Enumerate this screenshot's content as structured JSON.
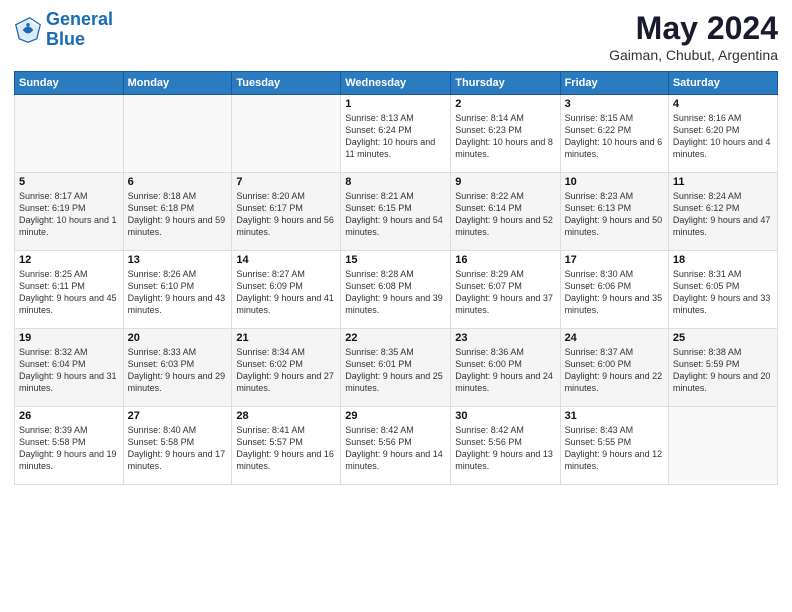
{
  "logo": {
    "line1": "General",
    "line2": "Blue"
  },
  "title": "May 2024",
  "subtitle": "Gaiman, Chubut, Argentina",
  "days_header": [
    "Sunday",
    "Monday",
    "Tuesday",
    "Wednesday",
    "Thursday",
    "Friday",
    "Saturday"
  ],
  "weeks": [
    [
      {
        "day": "",
        "sunrise": "",
        "sunset": "",
        "daylight": ""
      },
      {
        "day": "",
        "sunrise": "",
        "sunset": "",
        "daylight": ""
      },
      {
        "day": "",
        "sunrise": "",
        "sunset": "",
        "daylight": ""
      },
      {
        "day": "1",
        "sunrise": "Sunrise: 8:13 AM",
        "sunset": "Sunset: 6:24 PM",
        "daylight": "Daylight: 10 hours and 11 minutes."
      },
      {
        "day": "2",
        "sunrise": "Sunrise: 8:14 AM",
        "sunset": "Sunset: 6:23 PM",
        "daylight": "Daylight: 10 hours and 8 minutes."
      },
      {
        "day": "3",
        "sunrise": "Sunrise: 8:15 AM",
        "sunset": "Sunset: 6:22 PM",
        "daylight": "Daylight: 10 hours and 6 minutes."
      },
      {
        "day": "4",
        "sunrise": "Sunrise: 8:16 AM",
        "sunset": "Sunset: 6:20 PM",
        "daylight": "Daylight: 10 hours and 4 minutes."
      }
    ],
    [
      {
        "day": "5",
        "sunrise": "Sunrise: 8:17 AM",
        "sunset": "Sunset: 6:19 PM",
        "daylight": "Daylight: 10 hours and 1 minute."
      },
      {
        "day": "6",
        "sunrise": "Sunrise: 8:18 AM",
        "sunset": "Sunset: 6:18 PM",
        "daylight": "Daylight: 9 hours and 59 minutes."
      },
      {
        "day": "7",
        "sunrise": "Sunrise: 8:20 AM",
        "sunset": "Sunset: 6:17 PM",
        "daylight": "Daylight: 9 hours and 56 minutes."
      },
      {
        "day": "8",
        "sunrise": "Sunrise: 8:21 AM",
        "sunset": "Sunset: 6:15 PM",
        "daylight": "Daylight: 9 hours and 54 minutes."
      },
      {
        "day": "9",
        "sunrise": "Sunrise: 8:22 AM",
        "sunset": "Sunset: 6:14 PM",
        "daylight": "Daylight: 9 hours and 52 minutes."
      },
      {
        "day": "10",
        "sunrise": "Sunrise: 8:23 AM",
        "sunset": "Sunset: 6:13 PM",
        "daylight": "Daylight: 9 hours and 50 minutes."
      },
      {
        "day": "11",
        "sunrise": "Sunrise: 8:24 AM",
        "sunset": "Sunset: 6:12 PM",
        "daylight": "Daylight: 9 hours and 47 minutes."
      }
    ],
    [
      {
        "day": "12",
        "sunrise": "Sunrise: 8:25 AM",
        "sunset": "Sunset: 6:11 PM",
        "daylight": "Daylight: 9 hours and 45 minutes."
      },
      {
        "day": "13",
        "sunrise": "Sunrise: 8:26 AM",
        "sunset": "Sunset: 6:10 PM",
        "daylight": "Daylight: 9 hours and 43 minutes."
      },
      {
        "day": "14",
        "sunrise": "Sunrise: 8:27 AM",
        "sunset": "Sunset: 6:09 PM",
        "daylight": "Daylight: 9 hours and 41 minutes."
      },
      {
        "day": "15",
        "sunrise": "Sunrise: 8:28 AM",
        "sunset": "Sunset: 6:08 PM",
        "daylight": "Daylight: 9 hours and 39 minutes."
      },
      {
        "day": "16",
        "sunrise": "Sunrise: 8:29 AM",
        "sunset": "Sunset: 6:07 PM",
        "daylight": "Daylight: 9 hours and 37 minutes."
      },
      {
        "day": "17",
        "sunrise": "Sunrise: 8:30 AM",
        "sunset": "Sunset: 6:06 PM",
        "daylight": "Daylight: 9 hours and 35 minutes."
      },
      {
        "day": "18",
        "sunrise": "Sunrise: 8:31 AM",
        "sunset": "Sunset: 6:05 PM",
        "daylight": "Daylight: 9 hours and 33 minutes."
      }
    ],
    [
      {
        "day": "19",
        "sunrise": "Sunrise: 8:32 AM",
        "sunset": "Sunset: 6:04 PM",
        "daylight": "Daylight: 9 hours and 31 minutes."
      },
      {
        "day": "20",
        "sunrise": "Sunrise: 8:33 AM",
        "sunset": "Sunset: 6:03 PM",
        "daylight": "Daylight: 9 hours and 29 minutes."
      },
      {
        "day": "21",
        "sunrise": "Sunrise: 8:34 AM",
        "sunset": "Sunset: 6:02 PM",
        "daylight": "Daylight: 9 hours and 27 minutes."
      },
      {
        "day": "22",
        "sunrise": "Sunrise: 8:35 AM",
        "sunset": "Sunset: 6:01 PM",
        "daylight": "Daylight: 9 hours and 25 minutes."
      },
      {
        "day": "23",
        "sunrise": "Sunrise: 8:36 AM",
        "sunset": "Sunset: 6:00 PM",
        "daylight": "Daylight: 9 hours and 24 minutes."
      },
      {
        "day": "24",
        "sunrise": "Sunrise: 8:37 AM",
        "sunset": "Sunset: 6:00 PM",
        "daylight": "Daylight: 9 hours and 22 minutes."
      },
      {
        "day": "25",
        "sunrise": "Sunrise: 8:38 AM",
        "sunset": "Sunset: 5:59 PM",
        "daylight": "Daylight: 9 hours and 20 minutes."
      }
    ],
    [
      {
        "day": "26",
        "sunrise": "Sunrise: 8:39 AM",
        "sunset": "Sunset: 5:58 PM",
        "daylight": "Daylight: 9 hours and 19 minutes."
      },
      {
        "day": "27",
        "sunrise": "Sunrise: 8:40 AM",
        "sunset": "Sunset: 5:58 PM",
        "daylight": "Daylight: 9 hours and 17 minutes."
      },
      {
        "day": "28",
        "sunrise": "Sunrise: 8:41 AM",
        "sunset": "Sunset: 5:57 PM",
        "daylight": "Daylight: 9 hours and 16 minutes."
      },
      {
        "day": "29",
        "sunrise": "Sunrise: 8:42 AM",
        "sunset": "Sunset: 5:56 PM",
        "daylight": "Daylight: 9 hours and 14 minutes."
      },
      {
        "day": "30",
        "sunrise": "Sunrise: 8:42 AM",
        "sunset": "Sunset: 5:56 PM",
        "daylight": "Daylight: 9 hours and 13 minutes."
      },
      {
        "day": "31",
        "sunrise": "Sunrise: 8:43 AM",
        "sunset": "Sunset: 5:55 PM",
        "daylight": "Daylight: 9 hours and 12 minutes."
      },
      {
        "day": "",
        "sunrise": "",
        "sunset": "",
        "daylight": ""
      }
    ]
  ]
}
